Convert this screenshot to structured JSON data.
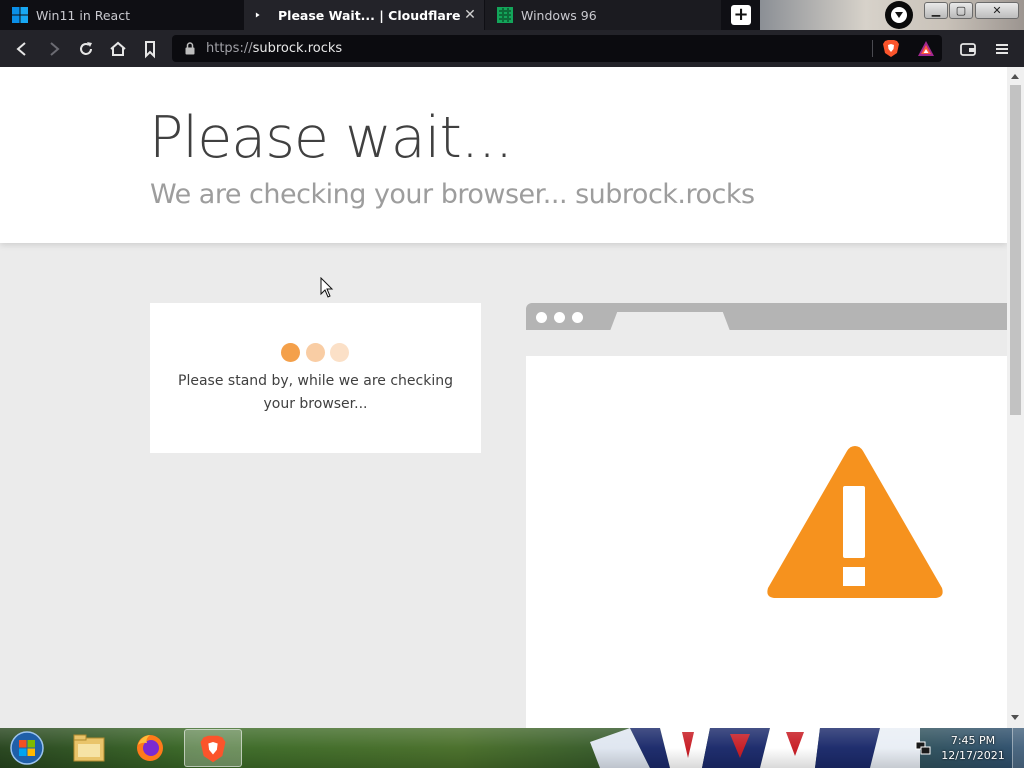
{
  "browser": {
    "tabs": [
      {
        "title": "Win11 in React",
        "active": false
      },
      {
        "title": "Please Wait... | Cloudflare",
        "active": true,
        "playing": true
      },
      {
        "title": "Windows 96",
        "active": false
      }
    ],
    "new_tab_label": "+",
    "url": {
      "scheme": "https://",
      "host": "subrock.rocks"
    },
    "window_controls": {
      "minimize": "▁",
      "maximize": "▢",
      "close": "✕"
    }
  },
  "page": {
    "title": "Please wait...",
    "subtitle": "We are checking your browser... subrock.rocks",
    "status_text": "Please stand by, while we are checking your browser...",
    "accent_color": "#f6921e",
    "dots": [
      {
        "color": "#f4a04a"
      },
      {
        "color": "#f9cda4"
      },
      {
        "color": "#fbe0c7"
      }
    ]
  },
  "taskbar": {
    "clock_time": "7:45 PM",
    "clock_date": "12/17/2021",
    "apps": [
      "start-orb",
      "file-explorer-icon",
      "firefox-icon",
      "brave-icon"
    ]
  }
}
